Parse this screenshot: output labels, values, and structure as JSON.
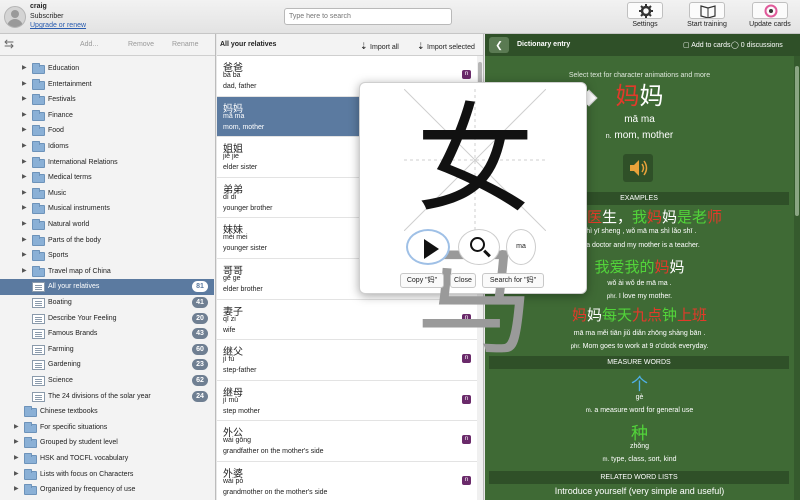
{
  "user": {
    "name": "craig",
    "role": "Subscriber",
    "upgrade": "Upgrade or renew"
  },
  "search": {
    "placeholder": "Type here to search"
  },
  "toolbar": {
    "settings": "Settings",
    "training": "Start training",
    "update": "Update cards"
  },
  "left_toolbar": {
    "add": "Add...",
    "remove": "Remove",
    "rename": "Rename"
  },
  "tree": {
    "categories": [
      "Education",
      "Entertainment",
      "Festivals",
      "Finance",
      "Food",
      "Idioms",
      "International Relations",
      "Medical terms",
      "Music",
      "Musical instruments",
      "Natural world",
      "Parts of the body",
      "Sports",
      "Travel map of China"
    ],
    "lists": [
      {
        "label": "All your relatives",
        "count": "81"
      },
      {
        "label": "Boating",
        "count": "41"
      },
      {
        "label": "Describe Your Feeling",
        "count": "20"
      },
      {
        "label": "Famous Brands",
        "count": "43"
      },
      {
        "label": "Farming",
        "count": "60"
      },
      {
        "label": "Gardening",
        "count": "23"
      },
      {
        "label": "Science",
        "count": "62"
      },
      {
        "label": "The 24 divisions of the solar year",
        "count": "24"
      }
    ],
    "chinese_textbooks": "Chinese textbooks",
    "groups": [
      "For specific situations",
      "Grouped by student level",
      "HSK  and TOCFL vocabulary",
      "Lists with focus on Characters",
      "Organized by frequency of use"
    ]
  },
  "mid": {
    "title": "All your relatives",
    "import_all": "Import all",
    "import_selected": "Import selected"
  },
  "words": [
    {
      "hz": "爸爸",
      "py": "bà ba",
      "en": "dad, father",
      "badge": "n"
    },
    {
      "hz": "妈妈",
      "py": "mā ma",
      "en": "mom, mother",
      "badge": ""
    },
    {
      "hz": "姐姐",
      "py": "jiě jie",
      "en": "elder sister",
      "badge": ""
    },
    {
      "hz": "弟弟",
      "py": "dì di",
      "en": "younger brother",
      "badge": ""
    },
    {
      "hz": "妹妹",
      "py": "mèi mei",
      "en": "younger sister",
      "badge": ""
    },
    {
      "hz": "哥哥",
      "py": "gē ge",
      "en": "elder brother",
      "badge": ""
    },
    {
      "hz": "妻子",
      "py": "qī zi",
      "en": "wife",
      "badge": "n"
    },
    {
      "hz": "继父",
      "py": "jì fù",
      "en": "step-father",
      "badge": "n"
    },
    {
      "hz": "继母",
      "py": "jì mǔ",
      "en": "step mother",
      "badge": "n"
    },
    {
      "hz": "外公",
      "py": "wài gōng",
      "en": "grandfather on the mother's side",
      "badge": "n"
    },
    {
      "hz": "外婆",
      "py": "wài pó",
      "en": "grandmother on the mother's side",
      "badge": "n"
    }
  ],
  "right": {
    "title": "Dictionary entry",
    "add_to_cards": "Add to cards",
    "discussions": "0 discussions",
    "hint": "Select text for character animations and more",
    "headword_1": "妈",
    "headword_2": "妈",
    "pinyin": "mā ma",
    "pos": "n.",
    "definition": "mom, mother",
    "examples_hdr": "EXAMPLES",
    "ex1_han": {
      "a": "爸是",
      "b": "医",
      "c": "生，",
      "d": "我",
      "e": "妈",
      "f": "妈",
      "g": "是",
      "h": "老",
      "i": "师"
    },
    "ex1_py": "shì yī sheng , wǒ mā ma shì lǎo shī .",
    "ex1_en": "is a doctor and my mother is a teacher.",
    "ex2_han": {
      "a": "我爱我的",
      "b": "妈",
      "c": "妈"
    },
    "ex2_py": "wǒ ài wǒ de mā ma .",
    "ex2_phr": "phr.",
    "ex2_en": "I love my mother.",
    "ex3_han": {
      "a": "妈",
      "b": "妈",
      "c": "每天",
      "d": "九点",
      "e": "钟",
      "f": "上班"
    },
    "ex3_py": "mā ma měi tiān jiǔ diǎn zhōng shàng bān .",
    "ex3_phr": "phr.",
    "ex3_en": "Mom goes to work at 9 o'clock everyday.",
    "measure_hdr": "MEASURE WORDS",
    "mw1_han": "个",
    "mw1_py": "gè",
    "mw1_pos": "m.",
    "mw1_en": "a measure word for general use",
    "mw2_han": "种",
    "mw2_py": "zhǒng",
    "mw2_pos": "m.",
    "mw2_en": "type, class, sort, kind",
    "related_hdr": "RELATED WORD LISTS",
    "related1": "Introduce yourself (very simple and useful)"
  },
  "popup": {
    "char_a": "女",
    "char_b": "马",
    "ma_label": "ma",
    "copy": "Copy \"妈\"",
    "close": "Close",
    "search_for": "Search for \"妈\""
  },
  "colors": {
    "selection": "#5b7aa0",
    "dict_bg": "#3f6a35",
    "red": "#e23a2a",
    "green": "#52d43a"
  }
}
